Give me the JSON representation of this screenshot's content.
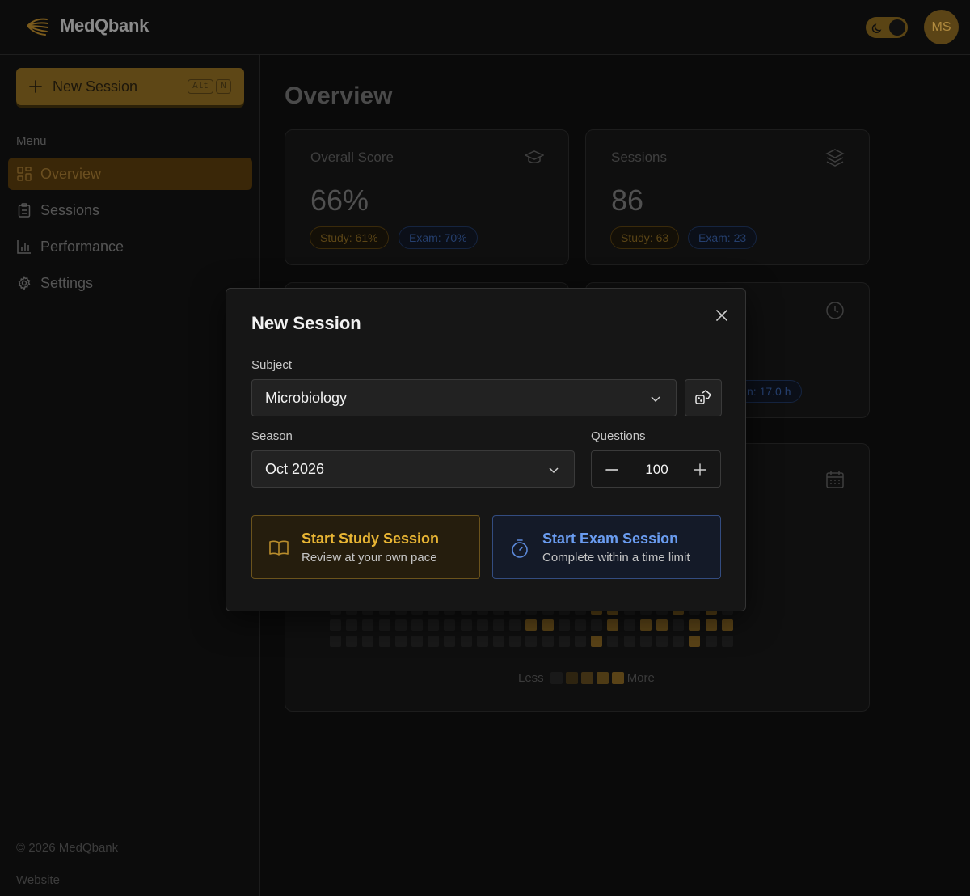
{
  "app": {
    "name": "MedQbank"
  },
  "user": {
    "initials": "MS"
  },
  "sidebar": {
    "new_session_label": "New Session",
    "shortcut_keys": [
      "Alt",
      "N"
    ],
    "menu_label": "Menu",
    "items": [
      {
        "label": "Overview",
        "icon": "grid-icon",
        "active": true
      },
      {
        "label": "Sessions",
        "icon": "clipboard-icon",
        "active": false
      },
      {
        "label": "Performance",
        "icon": "bar-chart-icon",
        "active": false
      },
      {
        "label": "Settings",
        "icon": "gear-icon",
        "active": false
      }
    ],
    "copyright": "© 2026 MedQbank",
    "website_link": "Website"
  },
  "main": {
    "title": "Overview",
    "cards": [
      {
        "label": "Overall Score",
        "value": "66%",
        "icon": "graduation-cap-icon",
        "pills": [
          "Study: 61%",
          "Exam: 70%"
        ]
      },
      {
        "label": "Sessions",
        "value": "86",
        "icon": "layers-icon",
        "pills": [
          "Study: 63",
          "Exam: 23"
        ]
      }
    ],
    "time_card": {
      "icon": "clock-icon",
      "partial_pill": "n: 17.0 h"
    },
    "activity": {
      "icon": "calendar-icon",
      "legend_less": "Less",
      "legend_more": "More"
    }
  },
  "modal": {
    "title": "New Session",
    "subject_label": "Subject",
    "subject_value": "Microbiology",
    "season_label": "Season",
    "season_value": "Oct 2026",
    "questions_label": "Questions",
    "questions_value": "100",
    "study_button": {
      "title": "Start Study Session",
      "subtitle": "Review at your own pace"
    },
    "exam_button": {
      "title": "Start Exam Session",
      "subtitle": "Complete within a time limit"
    }
  },
  "colors": {
    "accent": "#e8b534",
    "exam_accent": "#6a9cf0",
    "background": "#0a0a0a",
    "modal_bg": "#161616"
  }
}
